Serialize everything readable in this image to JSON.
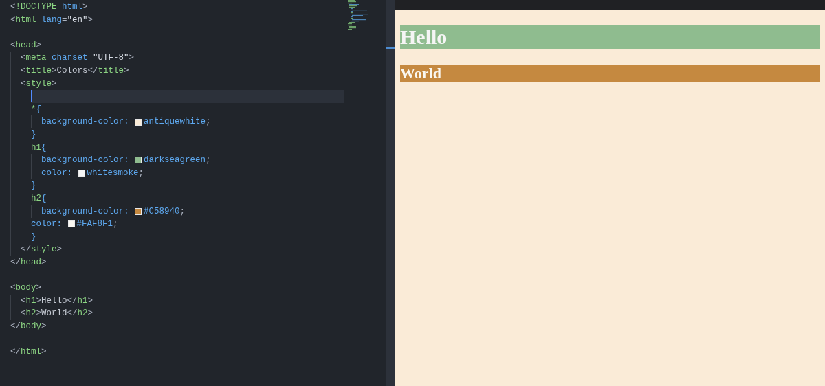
{
  "editor": {
    "lines": [
      {
        "tokens": [
          {
            "kind": "punct",
            "text": "<"
          },
          {
            "kind": "tag",
            "text": "!DOCTYPE"
          },
          {
            "kind": "attr",
            "text": " html"
          },
          {
            "kind": "punct",
            "text": ">"
          }
        ]
      },
      {
        "tokens": [
          {
            "kind": "punct",
            "text": "<"
          },
          {
            "kind": "tag",
            "text": "html"
          },
          {
            "kind": "attr",
            "text": " lang"
          },
          {
            "kind": "punct",
            "text": "="
          },
          {
            "kind": "string",
            "text": "\"en\""
          },
          {
            "kind": "punct",
            "text": ">"
          }
        ]
      },
      {
        "blank_before": true,
        "tokens": [
          {
            "kind": "punct",
            "text": "<"
          },
          {
            "kind": "tag",
            "text": "head"
          },
          {
            "kind": "punct",
            "text": ">"
          }
        ],
        "children": [
          {
            "tokens": [
              {
                "kind": "punct",
                "text": "<"
              },
              {
                "kind": "tag",
                "text": "meta"
              },
              {
                "kind": "attr",
                "text": " charset"
              },
              {
                "kind": "punct",
                "text": "="
              },
              {
                "kind": "string",
                "text": "\"UTF-8\""
              },
              {
                "kind": "punct",
                "text": ">"
              }
            ]
          },
          {
            "tokens": [
              {
                "kind": "punct",
                "text": "<"
              },
              {
                "kind": "tag",
                "text": "title"
              },
              {
                "kind": "punct",
                "text": ">"
              },
              {
                "kind": "text",
                "text": "Colors"
              },
              {
                "kind": "punct",
                "text": "</"
              },
              {
                "kind": "tag",
                "text": "title"
              },
              {
                "kind": "punct",
                "text": ">"
              }
            ]
          },
          {
            "tokens": [
              {
                "kind": "punct",
                "text": "<"
              },
              {
                "kind": "tag",
                "text": "style"
              },
              {
                "kind": "punct",
                "text": ">"
              }
            ],
            "children": [
              {
                "current": true
              },
              {
                "tokens": [
                  {
                    "kind": "selector",
                    "text": "*"
                  },
                  {
                    "kind": "brace",
                    "text": "{"
                  }
                ],
                "children": [
                  {
                    "tokens": [
                      {
                        "kind": "prop",
                        "text": "background-color: "
                      },
                      {
                        "kind": "swatch",
                        "color": "#faebd7"
                      },
                      {
                        "kind": "value",
                        "text": "antiquewhite"
                      },
                      {
                        "kind": "punct",
                        "text": ";"
                      }
                    ]
                  }
                ]
              },
              {
                "tokens": [
                  {
                    "kind": "brace",
                    "text": "}"
                  }
                ]
              },
              {
                "tokens": [
                  {
                    "kind": "selector",
                    "text": "h1"
                  },
                  {
                    "kind": "brace",
                    "text": "{"
                  }
                ],
                "children": [
                  {
                    "tokens": [
                      {
                        "kind": "prop",
                        "text": "background-color: "
                      },
                      {
                        "kind": "swatch",
                        "color": "#8fbc8f"
                      },
                      {
                        "kind": "value",
                        "text": "darkseagreen"
                      },
                      {
                        "kind": "punct",
                        "text": ";"
                      }
                    ]
                  },
                  {
                    "tokens": [
                      {
                        "kind": "prop",
                        "text": "color: "
                      },
                      {
                        "kind": "swatch",
                        "color": "#f5f5f5"
                      },
                      {
                        "kind": "value",
                        "text": "whitesmoke"
                      },
                      {
                        "kind": "punct",
                        "text": ";"
                      }
                    ]
                  }
                ]
              },
              {
                "tokens": [
                  {
                    "kind": "brace",
                    "text": "}"
                  }
                ]
              },
              {
                "tokens": [
                  {
                    "kind": "selector",
                    "text": "h2"
                  },
                  {
                    "kind": "brace",
                    "text": "{"
                  }
                ],
                "children": [
                  {
                    "tokens": [
                      {
                        "kind": "prop",
                        "text": "background-color: "
                      },
                      {
                        "kind": "swatch",
                        "color": "#c58940"
                      },
                      {
                        "kind": "value",
                        "text": "#C58940"
                      },
                      {
                        "kind": "punct",
                        "text": ";"
                      }
                    ]
                  }
                ]
              },
              {
                "tokens": [
                  {
                    "kind": "prop",
                    "text": "color: "
                  },
                  {
                    "kind": "swatch",
                    "color": "#faf8f1"
                  },
                  {
                    "kind": "value",
                    "text": "#FAF8F1"
                  },
                  {
                    "kind": "punct",
                    "text": ";"
                  }
                ]
              },
              {
                "tokens": [
                  {
                    "kind": "brace",
                    "text": "}"
                  }
                ]
              }
            ]
          },
          {
            "tokens": [
              {
                "kind": "punct",
                "text": "</"
              },
              {
                "kind": "tag",
                "text": "style"
              },
              {
                "kind": "punct",
                "text": ">"
              }
            ]
          }
        ]
      },
      {
        "tokens": [
          {
            "kind": "punct",
            "text": "</"
          },
          {
            "kind": "tag",
            "text": "head"
          },
          {
            "kind": "punct",
            "text": ">"
          }
        ]
      },
      {
        "blank_before": true,
        "tokens": [
          {
            "kind": "punct",
            "text": "<"
          },
          {
            "kind": "tag",
            "text": "body"
          },
          {
            "kind": "punct",
            "text": ">"
          }
        ],
        "children": [
          {
            "tokens": [
              {
                "kind": "punct",
                "text": "<"
              },
              {
                "kind": "tag",
                "text": "h1"
              },
              {
                "kind": "punct",
                "text": ">"
              },
              {
                "kind": "text",
                "text": "Hello"
              },
              {
                "kind": "punct",
                "text": "</"
              },
              {
                "kind": "tag",
                "text": "h1"
              },
              {
                "kind": "punct",
                "text": ">"
              }
            ]
          },
          {
            "tokens": [
              {
                "kind": "punct",
                "text": "<"
              },
              {
                "kind": "tag",
                "text": "h2"
              },
              {
                "kind": "punct",
                "text": ">"
              },
              {
                "kind": "text",
                "text": "World"
              },
              {
                "kind": "punct",
                "text": "</"
              },
              {
                "kind": "tag",
                "text": "h2"
              },
              {
                "kind": "punct",
                "text": ">"
              }
            ]
          }
        ]
      },
      {
        "tokens": [
          {
            "kind": "punct",
            "text": "</"
          },
          {
            "kind": "tag",
            "text": "body"
          },
          {
            "kind": "punct",
            "text": ">"
          }
        ]
      },
      {
        "blank_before": true,
        "tokens": [
          {
            "kind": "punct",
            "text": "</"
          },
          {
            "kind": "tag",
            "text": "html"
          },
          {
            "kind": "punct",
            "text": ">"
          }
        ]
      }
    ]
  },
  "preview": {
    "headings": [
      {
        "kind": "h1",
        "text": "Hello",
        "color": "#8fbc8f"
      },
      {
        "kind": "h2",
        "text": "World",
        "color": "#c58940"
      }
    ]
  }
}
